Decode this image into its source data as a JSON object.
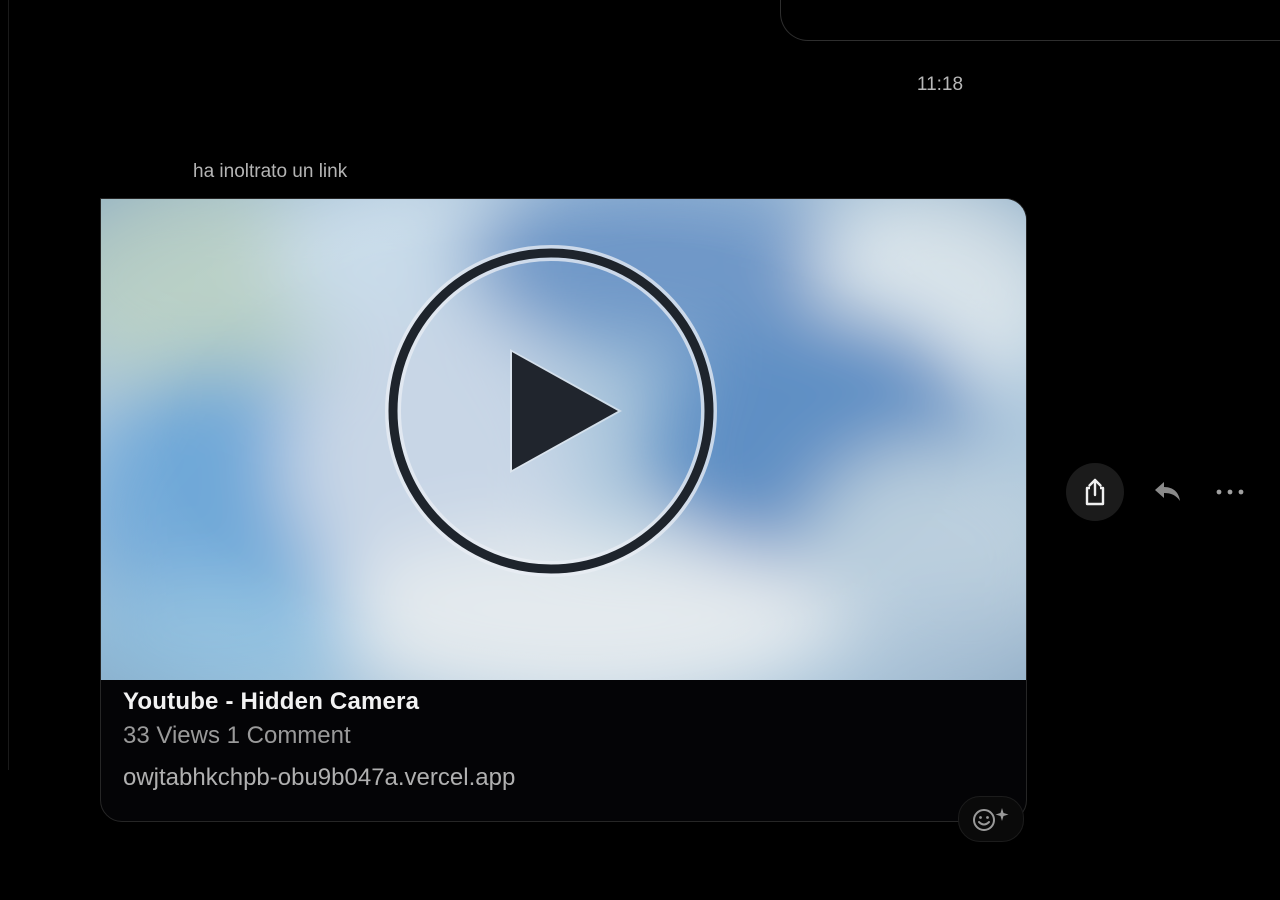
{
  "timestamp": "11:18",
  "forward": {
    "label": "ha inoltrato un link"
  },
  "link_card": {
    "title": "Youtube - Hidden Camera",
    "stats": "33 Views 1 Comment",
    "domain": "owjtabhkchpb-obu9b047a.vercel.app",
    "thumbnail_icon": "play-circle-icon"
  },
  "actions": {
    "share_icon": "share-icon",
    "reply_icon": "reply-icon",
    "more_icon": "more-dots-icon",
    "reaction_icon": "add-reaction-icon"
  },
  "colors": {
    "background": "#000000",
    "card_background": "#040406",
    "thumbnail_blue": "#9fbfd8",
    "title_text": "#f2f2f2",
    "secondary_text": "#9a9a9a"
  }
}
